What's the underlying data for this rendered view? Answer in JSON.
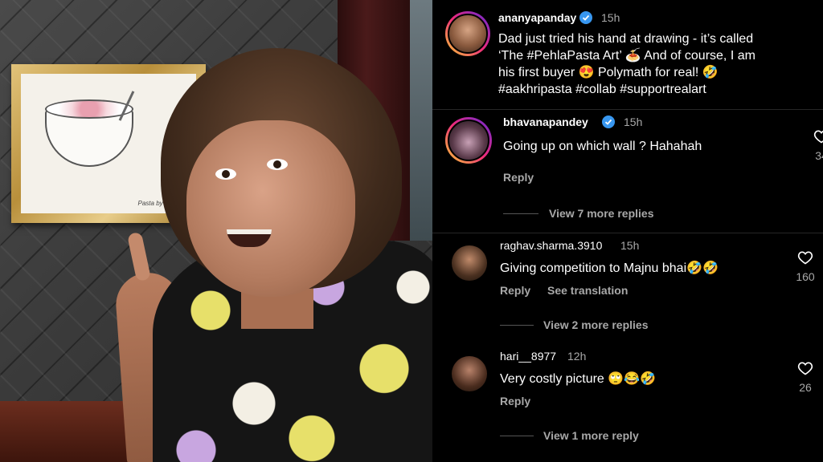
{
  "post": {
    "username": "ananyapanday",
    "time": "15h",
    "caption_lines": [
      "Dad just tried his hand at drawing - it’s called",
      "‘The #PehlaPasta Art’ 🍝 And of course, I am",
      "his first buyer 😍 Polymath for real! 🤣",
      "#aakhripasta #collab #supportrealart"
    ]
  },
  "comments": [
    {
      "username": "bhavanapandey",
      "time": "15h",
      "text": "Going up on which wall ? Hahahah",
      "reply_label": "Reply",
      "like_count": "34",
      "view_replies": "View 7 more replies"
    },
    {
      "username": "raghav.sharma.3910",
      "time": "15h",
      "text": "Giving competition to Majnu bhai🤣🤣",
      "reply_label": "Reply",
      "translation_label": "See translation",
      "like_count": "160",
      "view_replies": "View 2 more replies"
    },
    {
      "username": "hari__8977",
      "time": "12h",
      "text": "Very costly picture 🙄😂🤣",
      "reply_label": "Reply",
      "like_count": "26",
      "view_replies": "View 1 more reply"
    }
  ],
  "photo": {
    "artwork_signature": "Pasta by Chunky"
  },
  "colors": {
    "background": "#000000",
    "text_primary": "#ffffff",
    "text_secondary": "#a8a8a8",
    "verified_blue": "#3897f0"
  },
  "icons": {
    "verified": "verified-badge-icon",
    "like": "heart-outline-icon"
  }
}
